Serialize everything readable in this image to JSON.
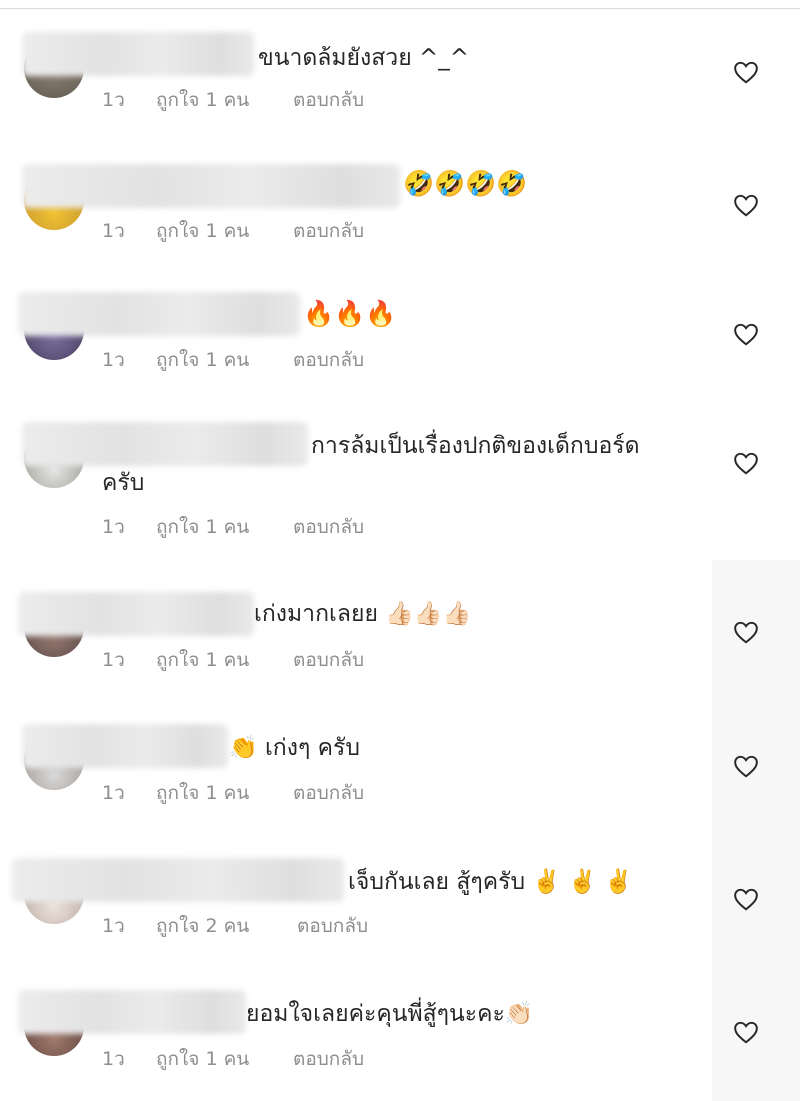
{
  "comments": [
    {
      "text": "ขนาดล้มยังสวย ^_^",
      "time": "1ว",
      "likes": "ถูกใจ 1 คน",
      "reply": "ตอบกลับ",
      "avatar_color": "#7d7264"
    },
    {
      "text": "🤣🤣🤣🤣",
      "time": "1ว",
      "likes": "ถูกใจ 1 คน",
      "reply": "ตอบกลับ",
      "avatar_color": "#d6a93b"
    },
    {
      "text": "🔥🔥🔥",
      "time": "1ว",
      "likes": "ถูกใจ 1 คน",
      "reply": "ตอบกลับ",
      "avatar_color": "#5a5273"
    },
    {
      "text": "การล้มเป็นเรื่องปกติของเด็กบอร์ด",
      "text2": "ครับ",
      "time": "1ว",
      "likes": "ถูกใจ 1 คน",
      "reply": "ตอบกลับ",
      "avatar_color": "#8a8f7c"
    },
    {
      "text": "เก่งมากเลยย 👍🏻👍🏻👍🏻",
      "time": "1ว",
      "likes": "ถูกใจ 1 คน",
      "reply": "ตอบกลับ",
      "avatar_color": "#8a6f68"
    },
    {
      "text": "👏 เก่งๆ ครับ",
      "time": "1ว",
      "likes": "ถูกใจ 1 คน",
      "reply": "ตอบกลับ",
      "avatar_color": "#9c8f87"
    },
    {
      "text": "เจ็บกันเลย สู้ๆครับ ✌️ ✌️ ✌️",
      "time": "1ว",
      "likes": "ถูกใจ 2 คน",
      "reply": "ตอบกลับ",
      "avatar_color": "#b7a9a0"
    },
    {
      "text": "ยอมใจเลยค่ะคุนพี่สู้ๆนะคะ👏🏻",
      "time": "1ว",
      "likes": "ถูกใจ 1 คน",
      "reply": "ตอบกลับ",
      "avatar_color": "#7a5a52"
    }
  ],
  "icons": {
    "like": "heart-outline-icon"
  }
}
